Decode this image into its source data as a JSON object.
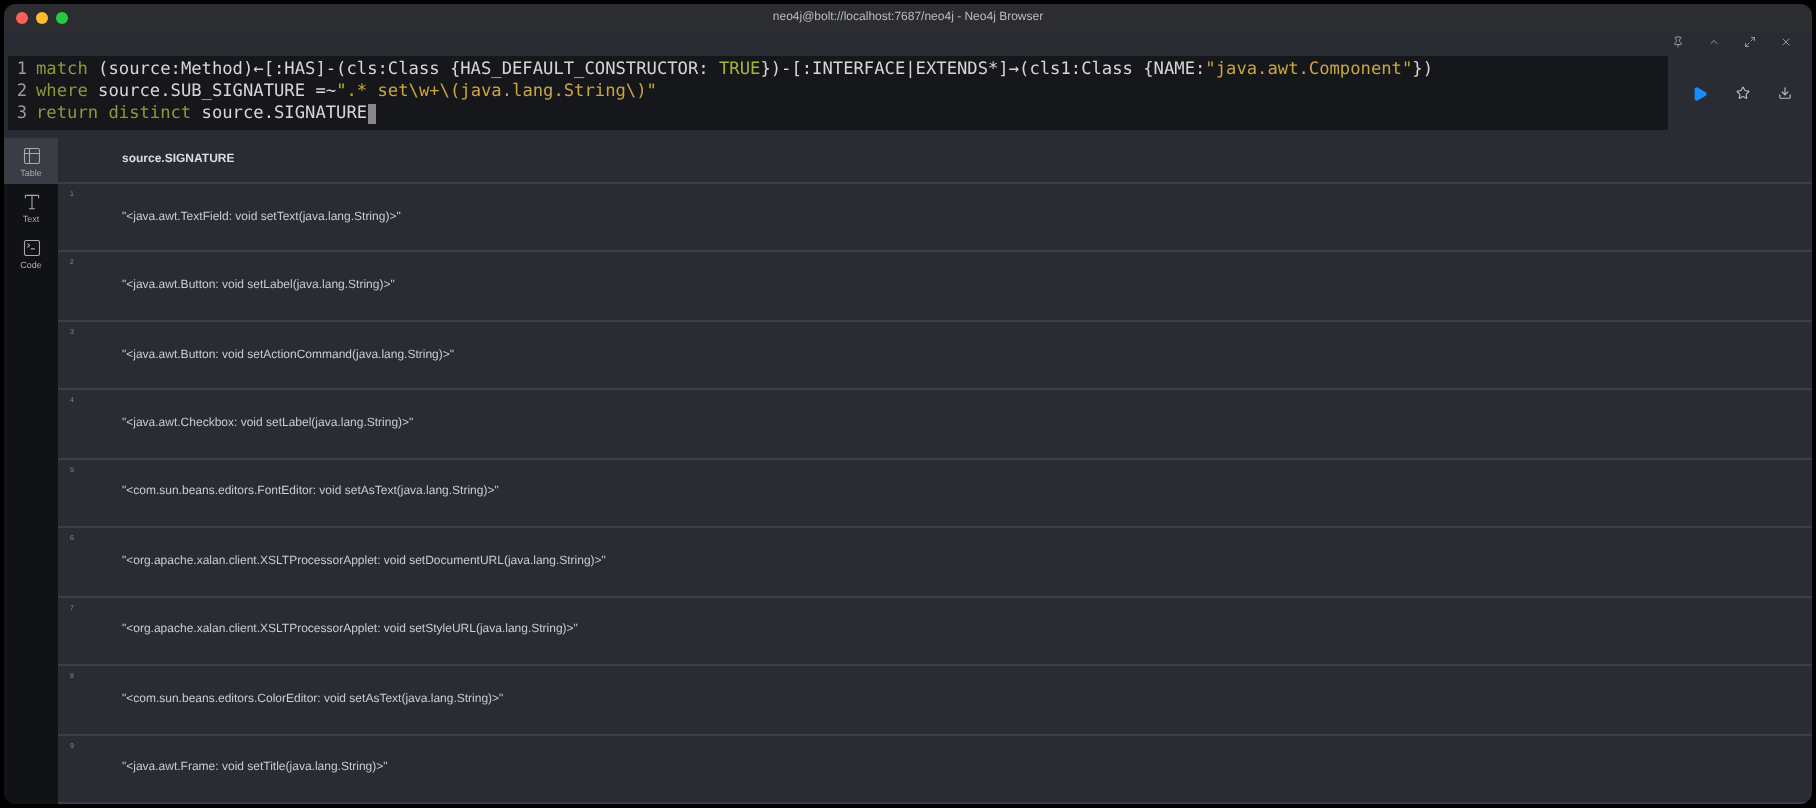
{
  "window": {
    "title": "neo4j@bolt://localhost:7687/neo4j - Neo4j Browser"
  },
  "editor": {
    "lines": [
      {
        "number": "1",
        "tokens": [
          {
            "kind": "keyword",
            "text": "match"
          },
          {
            "kind": "plain",
            "text": " (source:Method)←[:HAS]-(cls:Class {HAS_DEFAULT_CONSTRUCTOR: "
          },
          {
            "kind": "literal",
            "text": "TRUE"
          },
          {
            "kind": "plain",
            "text": "})-[:INTERFACE|EXTENDS*]→(cls1:Class {NAME:"
          },
          {
            "kind": "string",
            "text": "\"java.awt.Component\""
          },
          {
            "kind": "plain",
            "text": "})"
          }
        ]
      },
      {
        "number": "2",
        "tokens": [
          {
            "kind": "keyword",
            "text": "where"
          },
          {
            "kind": "plain",
            "text": " source.SUB_SIGNATURE =~"
          },
          {
            "kind": "string",
            "text": "\".* set\\w+\\(java.lang.String\\)\""
          }
        ]
      },
      {
        "number": "3",
        "tokens": [
          {
            "kind": "keyword",
            "text": "return distinct"
          },
          {
            "kind": "plain",
            "text": " source.SIGNATURE"
          }
        ]
      }
    ]
  },
  "views": [
    {
      "label": "Table",
      "kind": "table",
      "selected": true
    },
    {
      "label": "Text",
      "kind": "text",
      "selected": false
    },
    {
      "label": "Code",
      "kind": "code",
      "selected": false
    }
  ],
  "table": {
    "columns": [
      "source.SIGNATURE"
    ],
    "rows": [
      {
        "number": "1",
        "value": "\"<java.awt.TextField: void setText(java.lang.String)>\""
      },
      {
        "number": "2",
        "value": "\"<java.awt.Button: void setLabel(java.lang.String)>\""
      },
      {
        "number": "3",
        "value": "\"<java.awt.Button: void setActionCommand(java.lang.String)>\""
      },
      {
        "number": "4",
        "value": "\"<java.awt.Checkbox: void setLabel(java.lang.String)>\""
      },
      {
        "number": "5",
        "value": "\"<com.sun.beans.editors.FontEditor: void setAsText(java.lang.String)>\""
      },
      {
        "number": "6",
        "value": "\"<org.apache.xalan.client.XSLTProcessorApplet: void setDocumentURL(java.lang.String)>\""
      },
      {
        "number": "7",
        "value": "\"<org.apache.xalan.client.XSLTProcessorApplet: void setStyleURL(java.lang.String)>\""
      },
      {
        "number": "8",
        "value": "\"<com.sun.beans.editors.ColorEditor: void setAsText(java.lang.String)>\""
      },
      {
        "number": "9",
        "value": "\"<java.awt.Frame: void setTitle(java.lang.String)>\""
      }
    ]
  }
}
